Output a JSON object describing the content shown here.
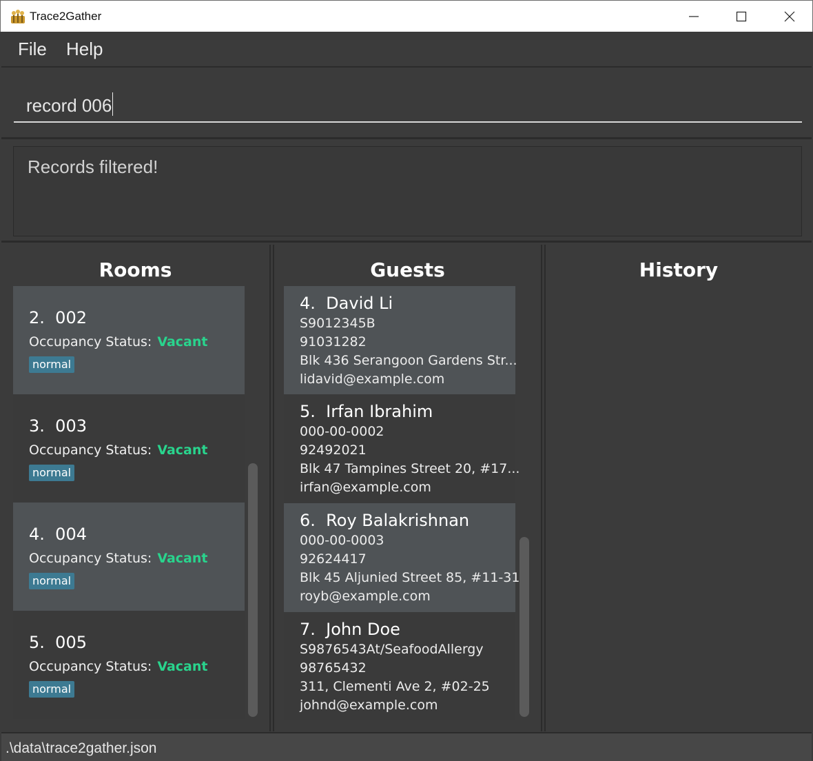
{
  "window": {
    "title": "Trace2Gather"
  },
  "menu": {
    "file": "File",
    "help": "Help"
  },
  "command": {
    "value": "record 006"
  },
  "result": {
    "message": "Records filtered!"
  },
  "rooms": {
    "heading": "Rooms",
    "status_label": "Occupancy Status:",
    "items": [
      {
        "index": "2.",
        "number": "002",
        "status": "Vacant",
        "tag": "normal"
      },
      {
        "index": "3.",
        "number": "003",
        "status": "Vacant",
        "tag": "normal"
      },
      {
        "index": "4.",
        "number": "004",
        "status": "Vacant",
        "tag": "normal"
      },
      {
        "index": "5.",
        "number": "005",
        "status": "Vacant",
        "tag": "normal"
      }
    ]
  },
  "guests": {
    "heading": "Guests",
    "items": [
      {
        "index": "4.",
        "name": "David Li",
        "id": "S9012345B",
        "phone": "91031282",
        "address": "Blk 436 Serangoon Gardens Str...",
        "email": "lidavid@example.com"
      },
      {
        "index": "5.",
        "name": "Irfan Ibrahim",
        "id": "000-00-0002",
        "phone": "92492021",
        "address": "Blk 47 Tampines Street 20, #17...",
        "email": "irfan@example.com"
      },
      {
        "index": "6.",
        "name": "Roy Balakrishnan",
        "id": "000-00-0003",
        "phone": "92624417",
        "address": "Blk 45 Aljunied Street 85, #11-31",
        "email": "royb@example.com"
      },
      {
        "index": "7.",
        "name": "John Doe",
        "id": "S9876543At/SeafoodAllergy",
        "phone": "98765432",
        "address": "311, Clementi Ave 2, #02-25",
        "email": "johnd@example.com"
      }
    ]
  },
  "history": {
    "heading": "History"
  },
  "status_bar": {
    "path": ".\\data\\trace2gather.json"
  },
  "colors": {
    "vacant": "#29d48d",
    "tag": "#3d7a92",
    "panel": "#3b3b3b",
    "card_light": "#4f5356"
  }
}
